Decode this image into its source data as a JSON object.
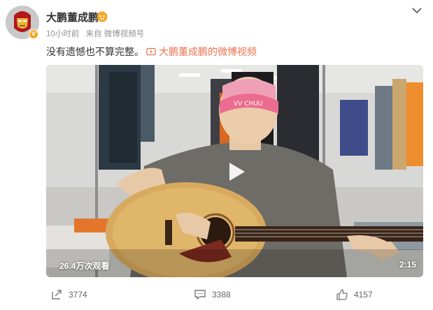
{
  "post": {
    "author_name": "大鹏董成鹏",
    "time_ago": "10小时前",
    "source": "来自 微博视频号",
    "text": "没有遗憾也不算完整。",
    "video_link_text": "大鹏董成鹏的微博视频"
  },
  "video": {
    "views": "26.4万次观看",
    "duration": "2:15",
    "headband_text": "VV CHUU"
  },
  "actions": {
    "reposts": "3774",
    "comments": "3388",
    "likes": "4157"
  },
  "colors": {
    "link": "#eb7350",
    "badge": "#f5a623",
    "text": "#333333",
    "muted": "#939393"
  },
  "icons": [
    "avatar-ironman",
    "fan-badge-icon",
    "chevron-down-icon",
    "video-link-icon",
    "play-icon",
    "repost-icon",
    "comment-icon",
    "like-icon"
  ]
}
